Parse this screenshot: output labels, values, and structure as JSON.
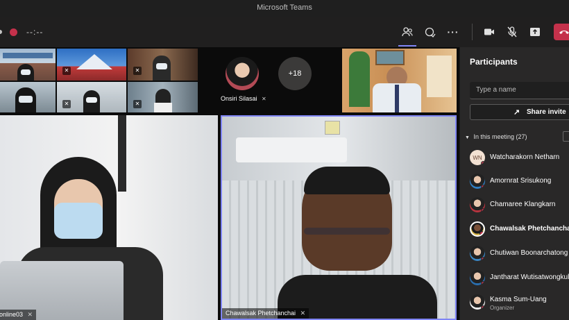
{
  "window": {
    "title": "Microsoft Teams"
  },
  "toolbar": {
    "timer": "--:--",
    "icons": [
      "people-icon",
      "reactions-icon",
      "more-icon",
      "camera-icon",
      "mic-off-icon",
      "share-tray-icon",
      "hang-up-icon"
    ],
    "accent": "#7f85f5",
    "leave_color": "#c4314b"
  },
  "stage": {
    "overflow_count": "+18",
    "center_participant": "Onsiri Silasai",
    "main_left_label": "online03",
    "main_right_label": "Chawalsak Phetchanchai"
  },
  "participants": {
    "title": "Participants",
    "search_placeholder": "Type a name",
    "invite_label": "Share invite",
    "section_label": "In this meeting (27)",
    "people": [
      {
        "name": "Watcharakorn Netharn",
        "initials": "WN",
        "bold": false,
        "role": ""
      },
      {
        "name": "Amornrat Srisukong",
        "initials": "",
        "bold": false,
        "role": ""
      },
      {
        "name": "Chamaree Klangkarn",
        "initials": "",
        "bold": false,
        "role": ""
      },
      {
        "name": "Chawalsak Phetchanchai",
        "initials": "",
        "bold": true,
        "role": ""
      },
      {
        "name": "Chutiwan Boonarchatong",
        "initials": "",
        "bold": false,
        "role": ""
      },
      {
        "name": "Jantharat Wutisatwongkul",
        "initials": "",
        "bold": false,
        "role": ""
      },
      {
        "name": "Kasma Sum-Uang",
        "initials": "",
        "bold": false,
        "role": "Organizer"
      }
    ]
  }
}
